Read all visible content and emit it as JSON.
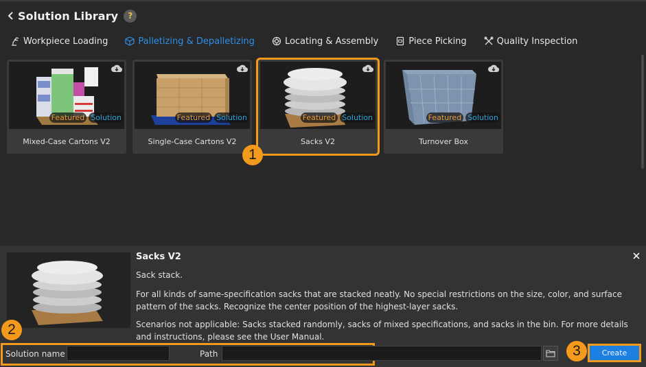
{
  "header": {
    "title": "Solution Library",
    "help_label": "?",
    "back_icon": "chevron-left-icon"
  },
  "tabs": [
    {
      "label": "Workpiece Loading",
      "icon": "robot-arm-icon",
      "active": false
    },
    {
      "label": "Palletizing & Depalletizing",
      "icon": "box-icon",
      "active": true
    },
    {
      "label": "Locating & Assembly",
      "icon": "gear-target-icon",
      "active": false
    },
    {
      "label": "Piece Picking",
      "icon": "package-icon",
      "active": false
    },
    {
      "label": "Quality Inspection",
      "icon": "tools-icon",
      "active": false
    }
  ],
  "cards": [
    {
      "name": "Mixed-Case Cartons V2",
      "badges": [
        "Featured",
        "Solution"
      ],
      "selected": false
    },
    {
      "name": "Single-Case Cartons V2",
      "badges": [
        "Featured",
        "Solution"
      ],
      "selected": false
    },
    {
      "name": "Sacks V2",
      "badges": [
        "Featured",
        "Solution"
      ],
      "selected": true
    },
    {
      "name": "Turnover Box",
      "badges": [
        "Featured",
        "Solution"
      ],
      "selected": false
    }
  ],
  "markers": [
    "1",
    "2",
    "3"
  ],
  "details": {
    "title": "Sacks V2",
    "short": "Sack stack.",
    "description": "For all kinds of same-specification sacks that are stacked neatly. No special restrictions on the size, color, and surface pattern of the sacks. Recognize the center position of the highest-layer sacks.",
    "note": "Scenarios not applicable: Sacks stacked randomly, sacks of mixed specifications, and sacks in the bin. For more details and instructions, please see the User Manual."
  },
  "form": {
    "solution_name_label": "Solution name",
    "solution_name_value": "",
    "path_label": "Path",
    "path_value": "",
    "create_label": "Create"
  },
  "colors": {
    "accent": "#2f8fe8",
    "highlight": "#f39a1d",
    "featured": "#e89a3c",
    "solution": "#2aa4e0",
    "create_button": "#1d7fe0"
  }
}
